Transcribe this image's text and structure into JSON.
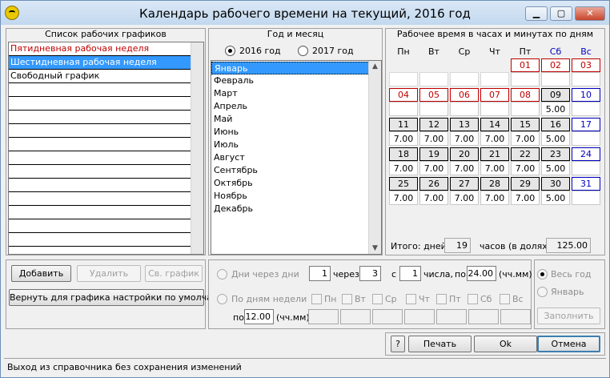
{
  "window": {
    "title": "Календарь рабочего времени на текущий, 2016 год"
  },
  "schedules": {
    "header": "Список рабочих графиков",
    "items": [
      "Пятидневная рабочая неделя",
      "Шестидневная рабочая неделя",
      "Свободный график"
    ],
    "selected_index": 1,
    "highlight_index": 0
  },
  "yearmonth": {
    "header": "Год и месяц",
    "year_options": [
      "2016 год",
      "2017 год"
    ],
    "selected_year": "2016 год",
    "months": [
      "Январь",
      "Февраль",
      "Март",
      "Апрель",
      "Май",
      "Июнь",
      "Июль",
      "Август",
      "Сентябрь",
      "Октябрь",
      "Ноябрь",
      "Декабрь"
    ],
    "selected_month": "Январь"
  },
  "calendar": {
    "header": "Рабочее время в часах и минутах по дням",
    "weekdays": [
      "Пн",
      "Вт",
      "Ср",
      "Чт",
      "Пт",
      "Сб",
      "Вс"
    ],
    "weeks": [
      {
        "days": [
          "",
          "",
          "",
          "",
          "01",
          "02",
          "03"
        ],
        "hours": [
          "",
          "",
          "",
          "",
          "",
          "",
          ""
        ]
      },
      {
        "days": [
          "04",
          "05",
          "06",
          "07",
          "08",
          "09",
          "10"
        ],
        "hours": [
          "",
          "",
          "",
          "",
          "",
          "5.00",
          ""
        ]
      },
      {
        "days": [
          "11",
          "12",
          "13",
          "14",
          "15",
          "16",
          "17"
        ],
        "hours": [
          "7.00",
          "7.00",
          "7.00",
          "7.00",
          "7.00",
          "5.00",
          ""
        ]
      },
      {
        "days": [
          "18",
          "19",
          "20",
          "21",
          "22",
          "23",
          "24"
        ],
        "hours": [
          "7.00",
          "7.00",
          "7.00",
          "7.00",
          "7.00",
          "5.00",
          ""
        ]
      },
      {
        "days": [
          "25",
          "26",
          "27",
          "28",
          "29",
          "30",
          "31"
        ],
        "hours": [
          "7.00",
          "7.00",
          "7.00",
          "7.00",
          "7.00",
          "5.00",
          ""
        ]
      }
    ],
    "holidays": [
      "01",
      "02",
      "03",
      "04",
      "05",
      "06",
      "07",
      "08"
    ],
    "totals": {
      "days_label": "Итого: дней",
      "days": "19",
      "hours_label": "часов (в долях)",
      "hours": "125.00"
    }
  },
  "actions": {
    "add": "Добавить",
    "delete": "Удалить",
    "graph": "Св. график",
    "reset": "Вернуть для графика настройки по умолчанию"
  },
  "fill": {
    "every_n_label": "Дни через дни",
    "n1": "1",
    "through": "через",
    "n2": "3",
    "from": "с",
    "n3": "1",
    "of_day": "числа,",
    "by": "по",
    "hours": "24.00",
    "unit": "(чч.мм)",
    "by_weekday_label": "По дням недели",
    "weekday_checks": [
      "Пн",
      "Вт",
      "Ср",
      "Чт",
      "Пт",
      "Сб",
      "Вс"
    ],
    "by2": "по",
    "hours2": "12.00",
    "unit2": "(чч.мм)",
    "whole_year": "Весь год",
    "month_opt": "Январь",
    "fill_button": "Заполнить"
  },
  "bottom": {
    "help": "?",
    "print": "Печать",
    "ok": "Ok",
    "cancel": "Отмена"
  },
  "status": "Выход из справочника без сохранения изменений"
}
